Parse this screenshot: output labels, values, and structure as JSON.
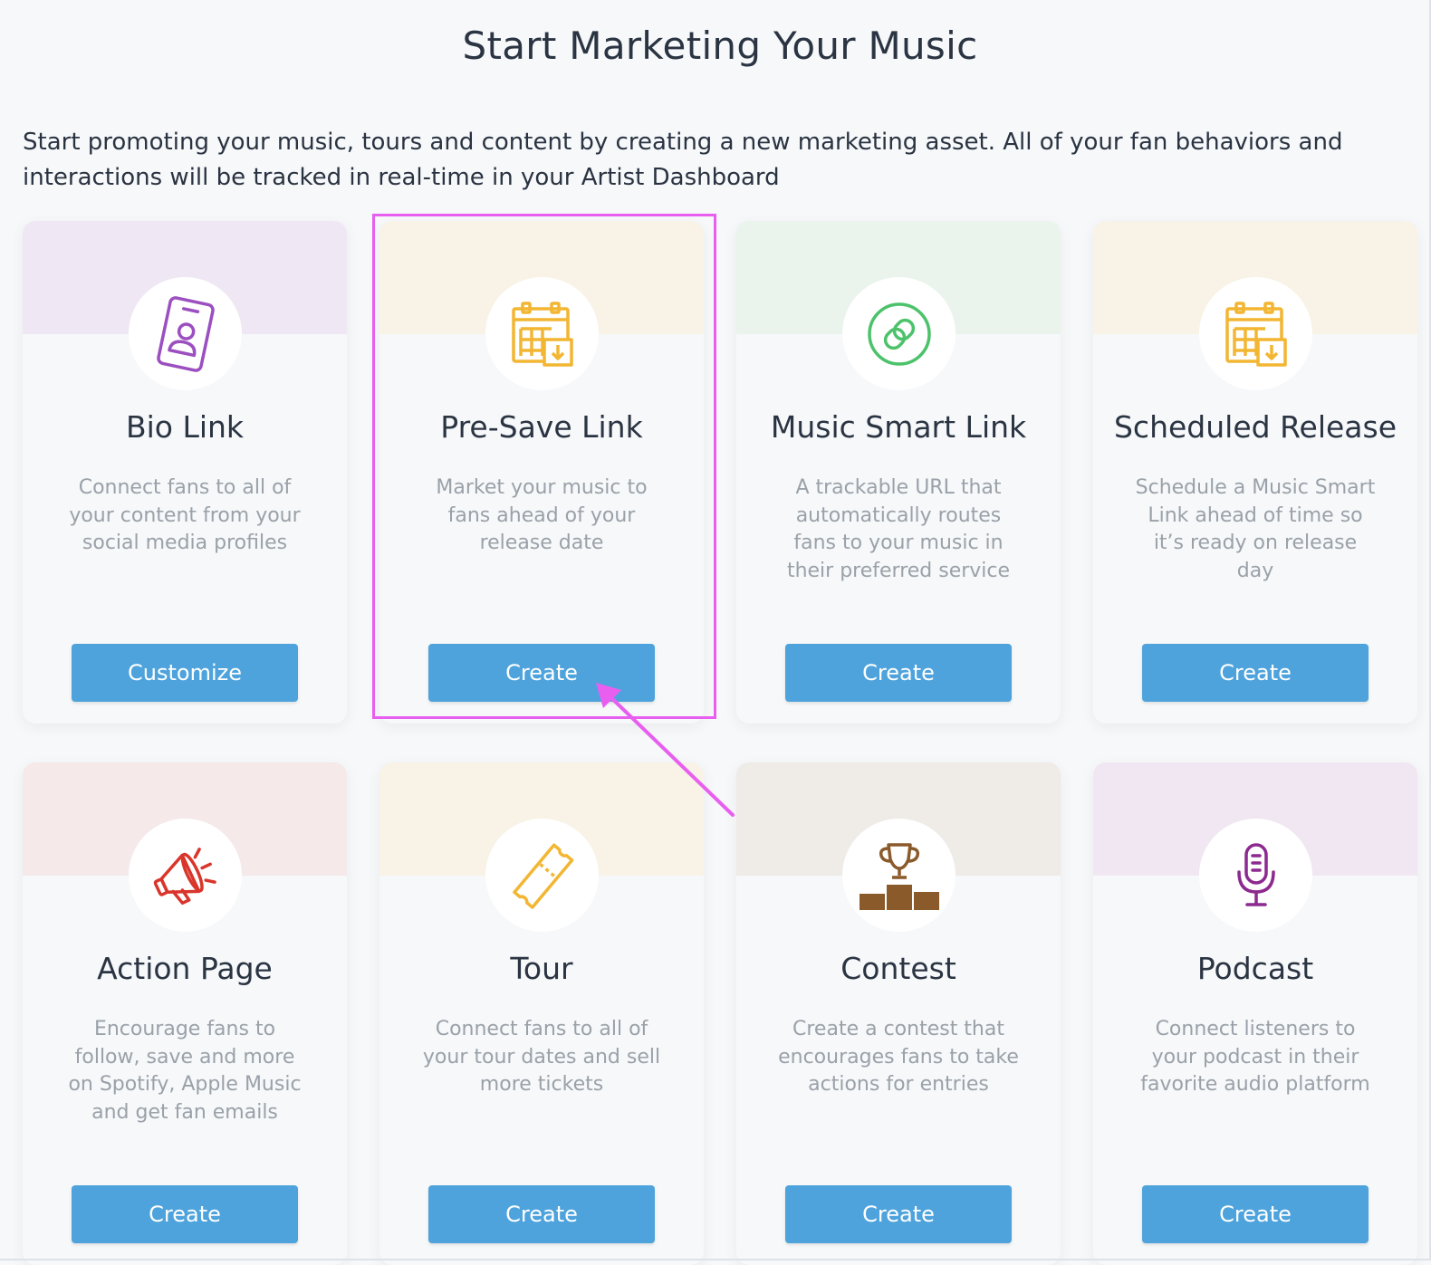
{
  "page": {
    "title": "Start Marketing Your Music",
    "intro": "Start promoting your music, tours and content by creating a new marketing asset. All of your fan behaviors and interactions will be tracked in real-time in your Artist Dashboard"
  },
  "cards": [
    {
      "title": "Bio Link",
      "description": "Connect fans to all of your content from your social media profiles",
      "button": "Customize",
      "icon": "id-badge-icon",
      "band_color": "#efe8f4",
      "icon_color": "#9b4fc0"
    },
    {
      "title": "Pre-Save Link",
      "description": "Market your music to fans ahead of your release date",
      "button": "Create",
      "icon": "calendar-download-icon",
      "band_color": "#f8f3e6",
      "icon_color": "#f2b632"
    },
    {
      "title": "Music Smart Link",
      "description": "A trackable URL that automatically routes fans to your music in their preferred service",
      "button": "Create",
      "icon": "link-icon",
      "band_color": "#eaf4ec",
      "icon_color": "#4cc26a"
    },
    {
      "title": "Scheduled Release",
      "description": "Schedule a Music Smart Link ahead of time so it’s ready on release day",
      "button": "Create",
      "icon": "calendar-download-icon",
      "band_color": "#f8f3e6",
      "icon_color": "#f2b632"
    },
    {
      "title": "Action Page",
      "description": "Encourage fans to follow, save and more on Spotify, Apple Music and get fan emails",
      "button": "Create",
      "icon": "megaphone-icon",
      "band_color": "#f5e9ea",
      "icon_color": "#d9352b"
    },
    {
      "title": "Tour",
      "description": "Connect fans to all of your tour dates and sell more tickets",
      "button": "Create",
      "icon": "ticket-icon",
      "band_color": "#f8f3e6",
      "icon_color": "#f2b632"
    },
    {
      "title": "Contest",
      "description": "Create a contest that encourages fans to take actions for entries",
      "button": "Create",
      "icon": "trophy-podium-icon",
      "band_color": "#efebe7",
      "icon_color": "#8a5a2b"
    },
    {
      "title": "Podcast",
      "description": "Connect listeners to your podcast in their favorite audio platform",
      "button": "Create",
      "icon": "microphone-icon",
      "band_color": "#f1e7f2",
      "icon_color": "#8c2a8f"
    }
  ],
  "annotation": {
    "highlight_color": "#e85ff0"
  }
}
